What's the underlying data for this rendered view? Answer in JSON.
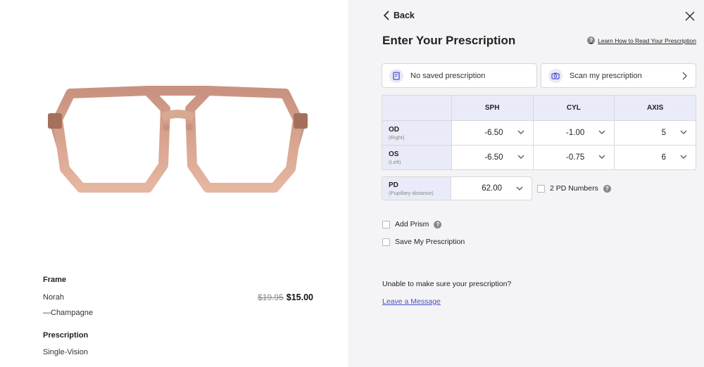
{
  "product": {
    "frame_heading": "Frame",
    "frame_name": "Norah",
    "frame_color": "—Champagne",
    "price_original": "$19.95",
    "price_current": "$15.00",
    "prescription_heading": "Prescription",
    "prescription_type": "Single-Vision"
  },
  "panel": {
    "back_label": "Back",
    "title": "Enter Your Prescription",
    "learn_link": "Learn How to Read Your Prescription",
    "saved_card": "No saved prescription",
    "scan_card": "Scan my prescription",
    "table": {
      "headers": [
        "SPH",
        "CYL",
        "AXIS"
      ],
      "rows": [
        {
          "eye": "OD",
          "eye_sub": "(Right)",
          "sph": "-6.50",
          "cyl": "-1.00",
          "axis": "5"
        },
        {
          "eye": "OS",
          "eye_sub": "(Left)",
          "sph": "-6.50",
          "cyl": "-0.75",
          "axis": "6"
        }
      ]
    },
    "pd": {
      "label": "PD",
      "sub": "(Pupillary distance)",
      "value": "62.00"
    },
    "two_pd_label": "2 PD Numbers",
    "add_prism_label": "Add Prism",
    "save_rx_label": "Save My Prescription",
    "unable_text": "Unable to make sure your prescription?",
    "leave_message": "Leave a Message"
  },
  "colors": {
    "panel_bg": "#f4f4f6",
    "frame_color": "#d59c84",
    "link_color": "#4b4fc7",
    "table_header_bg": "#e9ecf8"
  },
  "icons": [
    "chevron-left-icon",
    "close-icon",
    "help-icon",
    "document-icon",
    "camera-icon",
    "chevron-right-icon",
    "chevron-down-icon"
  ]
}
